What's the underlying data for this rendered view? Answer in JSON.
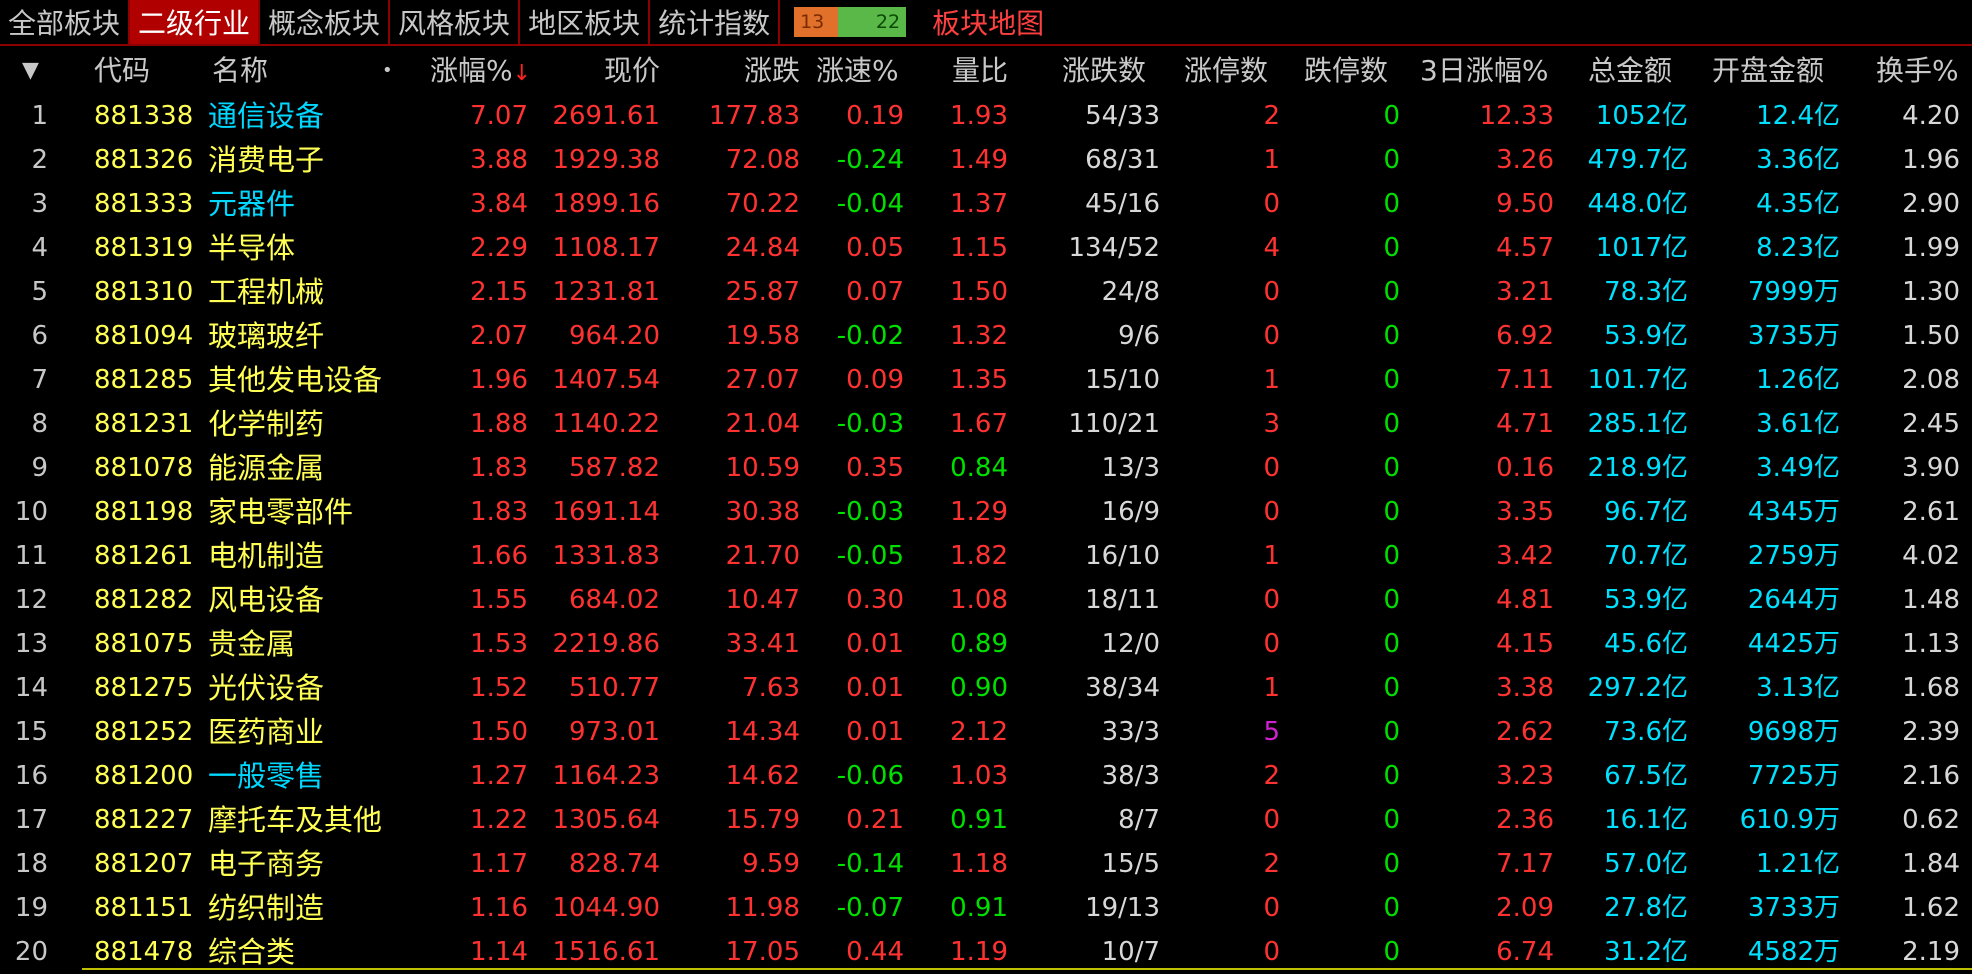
{
  "tabs": [
    "全部板块",
    "二级行业",
    "概念板块",
    "风格板块",
    "地区板块",
    "统计指数"
  ],
  "active_tab": 1,
  "updown": {
    "up": "13",
    "down": "22"
  },
  "map_tab": "板块地图",
  "colors": {
    "up": "#ff3232",
    "down": "#00e000",
    "code": "#ffff54",
    "highlight": "#00d8ff",
    "active_tab": "#b00000"
  },
  "columns": {
    "menu": "▼",
    "code": "代码",
    "name": "名称",
    "dot": "•",
    "pct": "涨幅%",
    "sort_indicator": "↓",
    "price": "现价",
    "change": "涨跌",
    "speed": "涨速%",
    "vol_ratio": "量比",
    "updown_count": "涨跌数",
    "limit_up": "涨停数",
    "limit_down": "跌停数",
    "pct3d": "3日涨幅%",
    "amount": "总金额",
    "open_amount": "开盘金额",
    "turnover": "换手%"
  },
  "rows": [
    {
      "idx": "1",
      "code": "881338",
      "name": "通信设备",
      "hl": true,
      "pct": "7.07",
      "price": "2691.61",
      "change": "177.83",
      "speed": "0.19",
      "vol_ratio": "1.93",
      "updown": "54/33",
      "limit_up": "2",
      "limit_down": "0",
      "pct3d": "12.33",
      "amount": "1052亿",
      "open_amount": "12.4亿",
      "turnover": "4.20"
    },
    {
      "idx": "2",
      "code": "881326",
      "name": "消费电子",
      "hl": false,
      "pct": "3.88",
      "price": "1929.38",
      "change": "72.08",
      "speed": "-0.24",
      "vol_ratio": "1.49",
      "updown": "68/31",
      "limit_up": "1",
      "limit_down": "0",
      "pct3d": "3.26",
      "amount": "479.7亿",
      "open_amount": "3.36亿",
      "turnover": "1.96"
    },
    {
      "idx": "3",
      "code": "881333",
      "name": "元器件",
      "hl": true,
      "pct": "3.84",
      "price": "1899.16",
      "change": "70.22",
      "speed": "-0.04",
      "vol_ratio": "1.37",
      "updown": "45/16",
      "limit_up": "0",
      "limit_down": "0",
      "pct3d": "9.50",
      "amount": "448.0亿",
      "open_amount": "4.35亿",
      "turnover": "2.90"
    },
    {
      "idx": "4",
      "code": "881319",
      "name": "半导体",
      "hl": false,
      "pct": "2.29",
      "price": "1108.17",
      "change": "24.84",
      "speed": "0.05",
      "vol_ratio": "1.15",
      "updown": "134/52",
      "limit_up": "4",
      "limit_down": "0",
      "pct3d": "4.57",
      "amount": "1017亿",
      "open_amount": "8.23亿",
      "turnover": "1.99"
    },
    {
      "idx": "5",
      "code": "881310",
      "name": "工程机械",
      "hl": false,
      "pct": "2.15",
      "price": "1231.81",
      "change": "25.87",
      "speed": "0.07",
      "vol_ratio": "1.50",
      "updown": "24/8",
      "limit_up": "0",
      "limit_down": "0",
      "pct3d": "3.21",
      "amount": "78.3亿",
      "open_amount": "7999万",
      "turnover": "1.30"
    },
    {
      "idx": "6",
      "code": "881094",
      "name": "玻璃玻纤",
      "hl": false,
      "pct": "2.07",
      "price": "964.20",
      "change": "19.58",
      "speed": "-0.02",
      "vol_ratio": "1.32",
      "updown": "9/6",
      "limit_up": "0",
      "limit_down": "0",
      "pct3d": "6.92",
      "amount": "53.9亿",
      "open_amount": "3735万",
      "turnover": "1.50"
    },
    {
      "idx": "7",
      "code": "881285",
      "name": "其他发电设备",
      "hl": false,
      "pct": "1.96",
      "price": "1407.54",
      "change": "27.07",
      "speed": "0.09",
      "vol_ratio": "1.35",
      "updown": "15/10",
      "limit_up": "1",
      "limit_down": "0",
      "pct3d": "7.11",
      "amount": "101.7亿",
      "open_amount": "1.26亿",
      "turnover": "2.08"
    },
    {
      "idx": "8",
      "code": "881231",
      "name": "化学制药",
      "hl": false,
      "pct": "1.88",
      "price": "1140.22",
      "change": "21.04",
      "speed": "-0.03",
      "vol_ratio": "1.67",
      "updown": "110/21",
      "limit_up": "3",
      "limit_down": "0",
      "pct3d": "4.71",
      "amount": "285.1亿",
      "open_amount": "3.61亿",
      "turnover": "2.45"
    },
    {
      "idx": "9",
      "code": "881078",
      "name": "能源金属",
      "hl": false,
      "pct": "1.83",
      "price": "587.82",
      "change": "10.59",
      "speed": "0.35",
      "vol_ratio": "0.84",
      "updown": "13/3",
      "limit_up": "0",
      "limit_down": "0",
      "pct3d": "0.16",
      "amount": "218.9亿",
      "open_amount": "3.49亿",
      "turnover": "3.90"
    },
    {
      "idx": "10",
      "code": "881198",
      "name": "家电零部件",
      "hl": false,
      "pct": "1.83",
      "price": "1691.14",
      "change": "30.38",
      "speed": "-0.03",
      "vol_ratio": "1.29",
      "updown": "16/9",
      "limit_up": "0",
      "limit_down": "0",
      "pct3d": "3.35",
      "amount": "96.7亿",
      "open_amount": "4345万",
      "turnover": "2.61"
    },
    {
      "idx": "11",
      "code": "881261",
      "name": "电机制造",
      "hl": false,
      "pct": "1.66",
      "price": "1331.83",
      "change": "21.70",
      "speed": "-0.05",
      "vol_ratio": "1.82",
      "updown": "16/10",
      "limit_up": "1",
      "limit_down": "0",
      "pct3d": "3.42",
      "amount": "70.7亿",
      "open_amount": "2759万",
      "turnover": "4.02"
    },
    {
      "idx": "12",
      "code": "881282",
      "name": "风电设备",
      "hl": false,
      "pct": "1.55",
      "price": "684.02",
      "change": "10.47",
      "speed": "0.30",
      "vol_ratio": "1.08",
      "updown": "18/11",
      "limit_up": "0",
      "limit_down": "0",
      "pct3d": "4.81",
      "amount": "53.9亿",
      "open_amount": "2644万",
      "turnover": "1.48"
    },
    {
      "idx": "13",
      "code": "881075",
      "name": "贵金属",
      "hl": false,
      "pct": "1.53",
      "price": "2219.86",
      "change": "33.41",
      "speed": "0.01",
      "vol_ratio": "0.89",
      "updown": "12/0",
      "limit_up": "0",
      "limit_down": "0",
      "pct3d": "4.15",
      "amount": "45.6亿",
      "open_amount": "4425万",
      "turnover": "1.13"
    },
    {
      "idx": "14",
      "code": "881275",
      "name": "光伏设备",
      "hl": false,
      "pct": "1.52",
      "price": "510.77",
      "change": "7.63",
      "speed": "0.01",
      "vol_ratio": "0.90",
      "updown": "38/34",
      "limit_up": "1",
      "limit_down": "0",
      "pct3d": "3.38",
      "amount": "297.2亿",
      "open_amount": "3.13亿",
      "turnover": "1.68"
    },
    {
      "idx": "15",
      "code": "881252",
      "name": "医药商业",
      "hl": false,
      "pct": "1.50",
      "price": "973.01",
      "change": "14.34",
      "speed": "0.01",
      "vol_ratio": "2.12",
      "updown": "33/3",
      "limit_up": "5",
      "limit_down": "0",
      "pct3d": "2.62",
      "amount": "73.6亿",
      "open_amount": "9698万",
      "turnover": "2.39"
    },
    {
      "idx": "16",
      "code": "881200",
      "name": "一般零售",
      "hl": true,
      "pct": "1.27",
      "price": "1164.23",
      "change": "14.62",
      "speed": "-0.06",
      "vol_ratio": "1.03",
      "updown": "38/3",
      "limit_up": "2",
      "limit_down": "0",
      "pct3d": "3.23",
      "amount": "67.5亿",
      "open_amount": "7725万",
      "turnover": "2.16"
    },
    {
      "idx": "17",
      "code": "881227",
      "name": "摩托车及其他",
      "hl": false,
      "pct": "1.22",
      "price": "1305.64",
      "change": "15.79",
      "speed": "0.21",
      "vol_ratio": "0.91",
      "updown": "8/7",
      "limit_up": "0",
      "limit_down": "0",
      "pct3d": "2.36",
      "amount": "16.1亿",
      "open_amount": "610.9万",
      "turnover": "0.62"
    },
    {
      "idx": "18",
      "code": "881207",
      "name": "电子商务",
      "hl": false,
      "pct": "1.17",
      "price": "828.74",
      "change": "9.59",
      "speed": "-0.14",
      "vol_ratio": "1.18",
      "updown": "15/5",
      "limit_up": "2",
      "limit_down": "0",
      "pct3d": "7.17",
      "amount": "57.0亿",
      "open_amount": "1.21亿",
      "turnover": "1.84"
    },
    {
      "idx": "19",
      "code": "881151",
      "name": "纺织制造",
      "hl": false,
      "pct": "1.16",
      "price": "1044.90",
      "change": "11.98",
      "speed": "-0.07",
      "vol_ratio": "0.91",
      "updown": "19/13",
      "limit_up": "0",
      "limit_down": "0",
      "pct3d": "2.09",
      "amount": "27.8亿",
      "open_amount": "3733万",
      "turnover": "1.62"
    },
    {
      "idx": "20",
      "code": "881478",
      "name": "综合类",
      "hl": false,
      "pct": "1.14",
      "price": "1516.61",
      "change": "17.05",
      "speed": "0.44",
      "vol_ratio": "1.19",
      "updown": "10/7",
      "limit_up": "0",
      "limit_down": "0",
      "pct3d": "6.74",
      "amount": "31.2亿",
      "open_amount": "4582万",
      "turnover": "2.19"
    }
  ]
}
